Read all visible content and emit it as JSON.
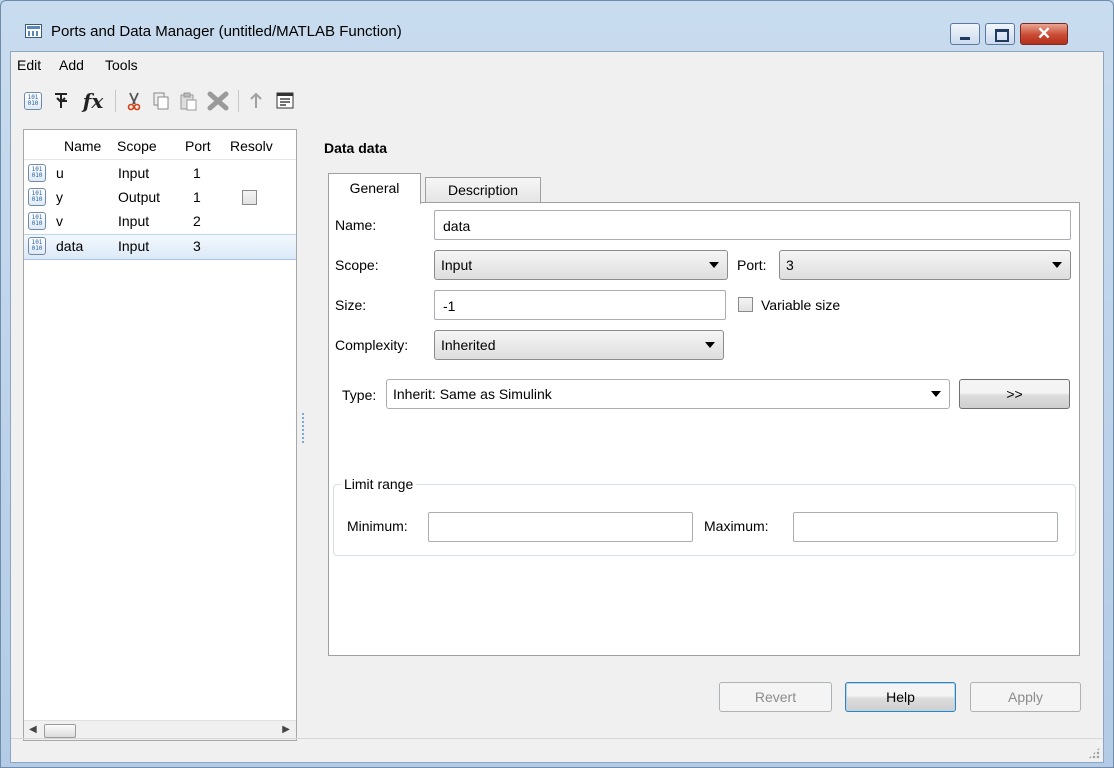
{
  "window": {
    "title": "Ports and Data Manager (untitled/MATLAB Function)"
  },
  "menu": [
    "Edit",
    "Add",
    "Tools"
  ],
  "toolbar": {
    "icons": [
      "add-data-icon",
      "add-event-icon",
      "add-function-icon",
      "cut-icon",
      "copy-icon",
      "paste-icon",
      "delete-icon",
      "move-up-icon",
      "model-explorer-icon"
    ],
    "fx_glyph": "fx"
  },
  "data_list": {
    "columns": [
      "Name",
      "Scope",
      "Port",
      "Resolv"
    ],
    "rows": [
      {
        "name": "u",
        "scope": "Input",
        "port": "1",
        "resolve": null
      },
      {
        "name": "y",
        "scope": "Output",
        "port": "1",
        "resolve": false
      },
      {
        "name": "v",
        "scope": "Input",
        "port": "2",
        "resolve": null
      },
      {
        "name": "data",
        "scope": "Input",
        "port": "3",
        "resolve": null
      }
    ],
    "selected_row": 3,
    "icon_glyph": "101\n010"
  },
  "details": {
    "title": "Data data",
    "tabs": [
      "General",
      "Description"
    ],
    "active_tab": "General",
    "name_label": "Name:",
    "name_value": "data",
    "scope_label": "Scope:",
    "scope_value": "Input",
    "port_label": "Port:",
    "port_value": "3",
    "size_label": "Size:",
    "size_value": "-1",
    "variable_size_label": "Variable size",
    "variable_size_checked": false,
    "complexity_label": "Complexity:",
    "complexity_value": "Inherited",
    "type_label": "Type:",
    "type_value": "Inherit: Same as Simulink",
    "type_button": ">>",
    "limit_range": {
      "title": "Limit range",
      "min_label": "Minimum:",
      "min_value": "",
      "max_label": "Maximum:",
      "max_value": ""
    }
  },
  "buttons": {
    "revert": "Revert",
    "help": "Help",
    "apply": "Apply"
  },
  "title_buttons": {
    "close_glyph": "✕"
  },
  "scroll": {
    "left": "◀",
    "right": "▶"
  }
}
